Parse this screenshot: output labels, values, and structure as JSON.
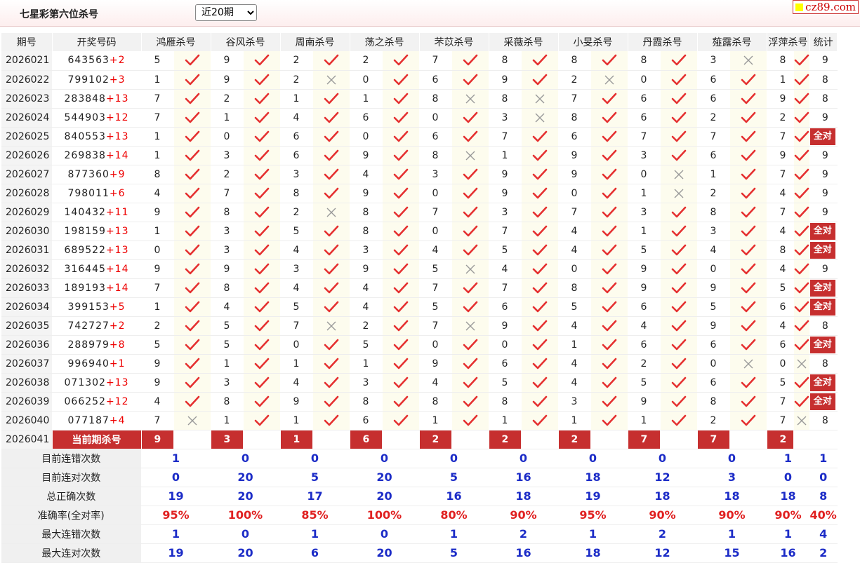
{
  "title": "七星彩第六位杀号",
  "range_select": "近20期",
  "logo_text": "cz89.com",
  "headers": [
    "期号",
    "开奖号码",
    "鸿雁杀号",
    "谷风杀号",
    "周南杀号",
    "荡之杀号",
    "芣苡杀号",
    "采薇杀号",
    "小旻杀号",
    "丹霞杀号",
    "薤露杀号",
    "浮萍杀号",
    "统计"
  ],
  "rows": [
    {
      "issue": "2026021",
      "draw": "643563",
      "special": "+2",
      "picks": [
        5,
        9,
        2,
        2,
        7,
        8,
        8,
        8,
        3,
        8
      ],
      "ok": [
        1,
        1,
        1,
        1,
        1,
        1,
        1,
        1,
        0,
        1
      ],
      "stat": "9"
    },
    {
      "issue": "2026022",
      "draw": "799102",
      "special": "+3",
      "picks": [
        1,
        9,
        2,
        0,
        6,
        9,
        2,
        0,
        6,
        1
      ],
      "ok": [
        1,
        1,
        0,
        1,
        1,
        1,
        0,
        1,
        1,
        1
      ],
      "stat": "8"
    },
    {
      "issue": "2026023",
      "draw": "283848",
      "special": "+13",
      "picks": [
        7,
        2,
        1,
        1,
        8,
        8,
        7,
        6,
        6,
        9
      ],
      "ok": [
        1,
        1,
        1,
        1,
        0,
        0,
        1,
        1,
        1,
        1
      ],
      "stat": "8"
    },
    {
      "issue": "2026024",
      "draw": "544903",
      "special": "+12",
      "picks": [
        7,
        1,
        4,
        6,
        0,
        3,
        8,
        6,
        2,
        2
      ],
      "ok": [
        1,
        1,
        1,
        1,
        1,
        0,
        1,
        1,
        1,
        1
      ],
      "stat": "9"
    },
    {
      "issue": "2026025",
      "draw": "840553",
      "special": "+13",
      "picks": [
        1,
        0,
        6,
        0,
        6,
        7,
        6,
        7,
        7,
        7
      ],
      "ok": [
        1,
        1,
        1,
        1,
        1,
        1,
        1,
        1,
        1,
        1
      ],
      "stat": "全对"
    },
    {
      "issue": "2026026",
      "draw": "269838",
      "special": "+14",
      "picks": [
        1,
        3,
        6,
        9,
        8,
        1,
        9,
        3,
        6,
        9
      ],
      "ok": [
        1,
        1,
        1,
        1,
        0,
        1,
        1,
        1,
        1,
        1
      ],
      "stat": "9"
    },
    {
      "issue": "2026027",
      "draw": "877360",
      "special": "+9",
      "picks": [
        8,
        2,
        3,
        4,
        3,
        9,
        9,
        0,
        1,
        7
      ],
      "ok": [
        1,
        1,
        1,
        1,
        1,
        1,
        1,
        0,
        1,
        1
      ],
      "stat": "9"
    },
    {
      "issue": "2026028",
      "draw": "798011",
      "special": "+6",
      "picks": [
        4,
        7,
        8,
        9,
        0,
        9,
        0,
        1,
        2,
        4
      ],
      "ok": [
        1,
        1,
        1,
        1,
        1,
        1,
        1,
        0,
        1,
        1
      ],
      "stat": "9"
    },
    {
      "issue": "2026029",
      "draw": "140432",
      "special": "+11",
      "picks": [
        9,
        8,
        2,
        8,
        7,
        3,
        7,
        3,
        8,
        7
      ],
      "ok": [
        1,
        1,
        0,
        1,
        1,
        1,
        1,
        1,
        1,
        1
      ],
      "stat": "9"
    },
    {
      "issue": "2026030",
      "draw": "198159",
      "special": "+13",
      "picks": [
        1,
        3,
        5,
        8,
        0,
        7,
        4,
        1,
        3,
        4
      ],
      "ok": [
        1,
        1,
        1,
        1,
        1,
        1,
        1,
        1,
        1,
        1
      ],
      "stat": "全对"
    },
    {
      "issue": "2026031",
      "draw": "689522",
      "special": "+13",
      "picks": [
        0,
        3,
        4,
        3,
        4,
        5,
        4,
        5,
        4,
        8
      ],
      "ok": [
        1,
        1,
        1,
        1,
        1,
        1,
        1,
        1,
        1,
        1
      ],
      "stat": "全对"
    },
    {
      "issue": "2026032",
      "draw": "316445",
      "special": "+14",
      "picks": [
        9,
        9,
        3,
        9,
        5,
        4,
        0,
        9,
        0,
        4
      ],
      "ok": [
        1,
        1,
        1,
        1,
        0,
        1,
        1,
        1,
        1,
        1
      ],
      "stat": "9"
    },
    {
      "issue": "2026033",
      "draw": "189193",
      "special": "+14",
      "picks": [
        7,
        8,
        4,
        4,
        7,
        7,
        8,
        9,
        9,
        5
      ],
      "ok": [
        1,
        1,
        1,
        1,
        1,
        1,
        1,
        1,
        1,
        1
      ],
      "stat": "全对"
    },
    {
      "issue": "2026034",
      "draw": "399153",
      "special": "+5",
      "picks": [
        1,
        4,
        5,
        4,
        5,
        6,
        5,
        6,
        5,
        6
      ],
      "ok": [
        1,
        1,
        1,
        1,
        1,
        1,
        1,
        1,
        1,
        1
      ],
      "stat": "全对"
    },
    {
      "issue": "2026035",
      "draw": "742727",
      "special": "+2",
      "picks": [
        2,
        5,
        7,
        2,
        7,
        9,
        4,
        4,
        9,
        4
      ],
      "ok": [
        1,
        1,
        0,
        1,
        0,
        1,
        1,
        1,
        1,
        1
      ],
      "stat": "8"
    },
    {
      "issue": "2026036",
      "draw": "288979",
      "special": "+8",
      "picks": [
        5,
        5,
        0,
        5,
        0,
        0,
        1,
        6,
        6,
        6
      ],
      "ok": [
        1,
        1,
        1,
        1,
        1,
        1,
        1,
        1,
        1,
        1
      ],
      "stat": "全对"
    },
    {
      "issue": "2026037",
      "draw": "996940",
      "special": "+1",
      "picks": [
        9,
        1,
        1,
        1,
        9,
        6,
        4,
        2,
        0,
        0
      ],
      "ok": [
        1,
        1,
        1,
        1,
        1,
        1,
        1,
        1,
        0,
        0
      ],
      "stat": "8"
    },
    {
      "issue": "2026038",
      "draw": "071302",
      "special": "+13",
      "picks": [
        9,
        3,
        4,
        3,
        4,
        5,
        4,
        5,
        6,
        5
      ],
      "ok": [
        1,
        1,
        1,
        1,
        1,
        1,
        1,
        1,
        1,
        1
      ],
      "stat": "全对"
    },
    {
      "issue": "2026039",
      "draw": "066252",
      "special": "+12",
      "picks": [
        4,
        8,
        9,
        8,
        8,
        8,
        3,
        9,
        8,
        7
      ],
      "ok": [
        1,
        1,
        1,
        1,
        1,
        1,
        1,
        1,
        1,
        1
      ],
      "stat": "全对"
    },
    {
      "issue": "2026040",
      "draw": "077187",
      "special": "+4",
      "picks": [
        7,
        1,
        1,
        6,
        1,
        1,
        1,
        1,
        2,
        7
      ],
      "ok": [
        0,
        1,
        1,
        1,
        1,
        1,
        1,
        1,
        1,
        0
      ],
      "stat": "8"
    }
  ],
  "current": {
    "issue": "2026041",
    "label": "当前期杀号",
    "picks": [
      9,
      3,
      1,
      6,
      2,
      2,
      2,
      7,
      7,
      2
    ]
  },
  "summary": [
    {
      "label": "目前连错次数",
      "values": [
        "1",
        "0",
        "0",
        "0",
        "0",
        "0",
        "0",
        "0",
        "0",
        "1",
        "1"
      ],
      "rate": false
    },
    {
      "label": "目前连对次数",
      "values": [
        "0",
        "20",
        "5",
        "20",
        "5",
        "16",
        "18",
        "12",
        "3",
        "0",
        "0"
      ],
      "rate": false
    },
    {
      "label": "总正确次数",
      "values": [
        "19",
        "20",
        "17",
        "20",
        "16",
        "18",
        "19",
        "18",
        "18",
        "18",
        "8"
      ],
      "rate": false
    },
    {
      "label": "准确率(全对率)",
      "values": [
        "95%",
        "100%",
        "85%",
        "100%",
        "80%",
        "90%",
        "95%",
        "90%",
        "90%",
        "90%",
        "40%"
      ],
      "rate": true
    },
    {
      "label": "最大连错次数",
      "values": [
        "1",
        "0",
        "1",
        "0",
        "1",
        "2",
        "1",
        "2",
        "1",
        "1",
        "4"
      ],
      "rate": false
    },
    {
      "label": "最大连对次数",
      "values": [
        "19",
        "20",
        "6",
        "20",
        "5",
        "16",
        "18",
        "12",
        "15",
        "16",
        "2"
      ],
      "rate": false
    }
  ],
  "colors": {
    "check": "#e53030",
    "cross": "#999999",
    "current_bg": "#c62f2f",
    "summary_value": "#1c2cc7",
    "rate_value": "#e02020"
  }
}
